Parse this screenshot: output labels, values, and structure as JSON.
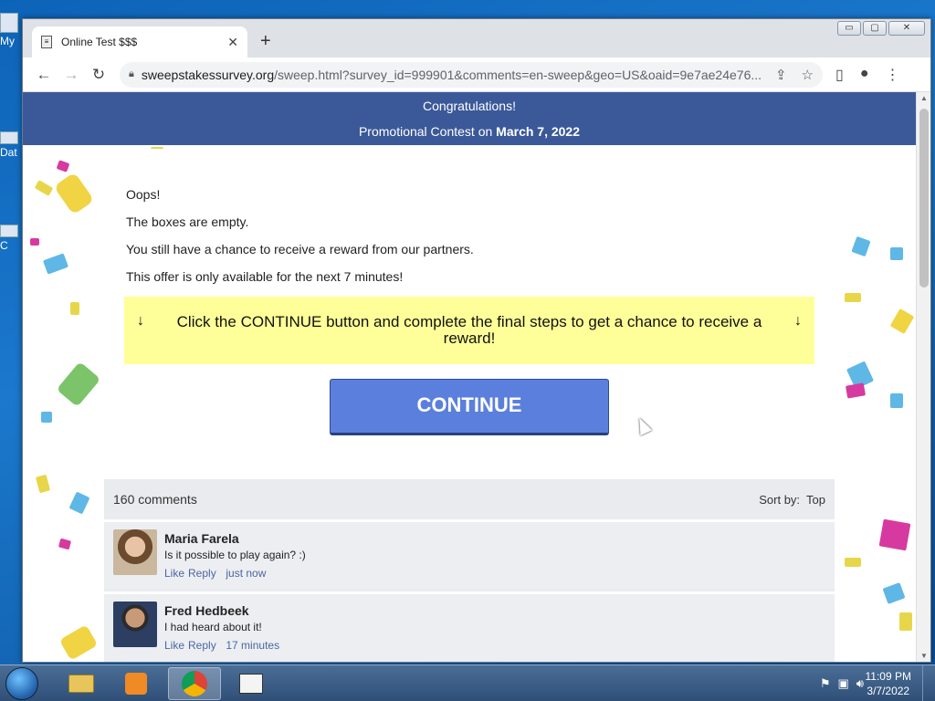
{
  "desktop": {
    "icon1_label": "My",
    "icon2_label": "Dat",
    "icon3_label": "C"
  },
  "browser": {
    "tab_title": "Online Test $$$",
    "tab_close": "✕",
    "new_tab": "+",
    "url_host": "sweepstakessurvey.org",
    "url_rest": "/sweep.html?survey_id=999901&comments=en-sweep&geo=US&oaid=9e7ae24e76...",
    "window_controls": [
      "▭",
      "▢",
      "✕"
    ]
  },
  "page": {
    "banner": {
      "title": "Congratulations!",
      "subtitle_prefix": "Promotional Contest on ",
      "subtitle_date": "March 7, 2022"
    },
    "messages": [
      "Oops!",
      "The boxes are empty.",
      "You still have a chance to receive a reward from our partners.",
      "This offer is only available for the next 7 minutes!"
    ],
    "callout_text": "Click the CONTINUE button and complete the final steps to get a chance to receive a reward!",
    "arrow_glyph": "↓",
    "continue_label": "CONTINUE",
    "comments": {
      "count_label": "160 comments",
      "sort_label": "Sort by:",
      "sort_value": "Top",
      "items": [
        {
          "name": "Maria Farela",
          "text": "Is it possible to play again? :)",
          "like": "Like",
          "reply": "Reply",
          "time": "just now"
        },
        {
          "name": "Fred Hedbeek",
          "text": "I had heard about it!",
          "like": "Like",
          "reply": "Reply",
          "time": "17 minutes"
        }
      ]
    }
  },
  "taskbar": {
    "time": "11:09 PM",
    "date": "3/7/2022"
  },
  "colors": {
    "banner": "#3b5998",
    "button": "#5b7fdc",
    "callout": "#ffff99"
  }
}
